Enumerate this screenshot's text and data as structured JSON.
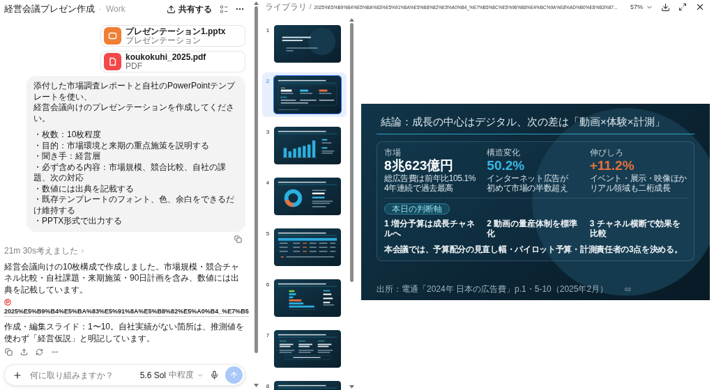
{
  "chat": {
    "title": "経営会議プレゼン作成",
    "separator": "·",
    "workspace": "Work",
    "share_label": "共有する",
    "attachments": [
      {
        "kind": "presentation",
        "name": "プレゼンテーション1.pptx",
        "type": "プレゼンテーション"
      },
      {
        "kind": "pdf",
        "name": "koukokuhi_2025.pdf",
        "type": "PDF"
      }
    ],
    "user_message": {
      "lines": [
        "添付した市場調査レポートと自社のPowerPointテンプレートを使い、",
        "経営会議向けのプレゼンテーションを作成してください。"
      ],
      "bullets": [
        "・枚数：10枚程度",
        "・目的：市場環境と来期の重点施策を説明する",
        "・聞き手：経営層",
        "・必ず含める内容：市場規模、競合比較、自社の課題、次の対応",
        "・数値には出典を記載する",
        "・既存テンプレートのフォント、色、余白をできるだけ維持する",
        "・PPTX形式で出力する"
      ]
    },
    "thought": "21m 30s考えました",
    "reply": "経営会議向けの10枚構成で作成しました。市場規模・競合チャネル比較・自社課題・来期施策・90日計画を含み、数値には出典を記載しています。",
    "file_link": "2025%E5%B9%B4%E5%BA%83%E5%91%8A%E5%B8%82%E5%A0%B4_%E7%B5",
    "note": "作成・編集スライド：1〜10。自社実績がない箇所は、推測値を使わず「経営仮説」と明記しています。",
    "composer": {
      "placeholder": "何に取り組みますか？",
      "model": "5.6 Sol",
      "effort": "中程度"
    }
  },
  "viewer": {
    "root": "ライブラリ",
    "separator": "/",
    "path": "2025%E5%B9%B4%E5%BA%83%E5%91%8A%E5%B8%82%E5%A0%B4_%E7%B5%8C%E5%96%B6%E4%BC%9A%E8%AD%B0%E8%B3%87...",
    "zoom": "57%"
  },
  "thumbnails": [
    {
      "number": "1",
      "kind": "title",
      "selected": false
    },
    {
      "number": "2",
      "kind": "summary",
      "selected": true
    },
    {
      "number": "3",
      "kind": "bar_chart",
      "selected": false
    },
    {
      "number": "4",
      "kind": "donut",
      "selected": false
    },
    {
      "number": "5",
      "kind": "table",
      "selected": false
    },
    {
      "number": "6",
      "kind": "hbar_chart",
      "selected": false
    },
    {
      "number": "7",
      "kind": "columns",
      "selected": false
    },
    {
      "number": "8",
      "kind": "text",
      "selected": false
    }
  ],
  "slide": {
    "title": "結論：成長の中心はデジタル、次の差は「動画×体験×計測」",
    "metrics": [
      {
        "label": "市場",
        "value": "8兆623億円",
        "color": "#ffffff",
        "notes": [
          "総広告費は前年比105.1%",
          "4年連続で過去最高"
        ]
      },
      {
        "label": "構造変化",
        "value": "50.2%",
        "color": "#37b9e6",
        "notes": [
          "インターネット広告が",
          "初めて市場の半数超え"
        ]
      },
      {
        "label": "伸びしろ",
        "value": "+11.2%",
        "color": "#e8703a",
        "notes": [
          "イベント・展示・映像ほか",
          "リアル領域も二桁成長"
        ]
      }
    ],
    "decision_label": "本日の判断軸",
    "decisions": [
      "1 増分予算は成長チャネルへ",
      "2 動画の量産体制を標準化",
      "3 チャネル横断で効果を比較"
    ],
    "conclusion": "本会議では、予算配分の見直し幅・パイロット予算・計測責任者の3点を決める。",
    "source": "出所：電通「2024年 日本の広告費」p.1・5-10（2025年2月）",
    "page": "02"
  }
}
